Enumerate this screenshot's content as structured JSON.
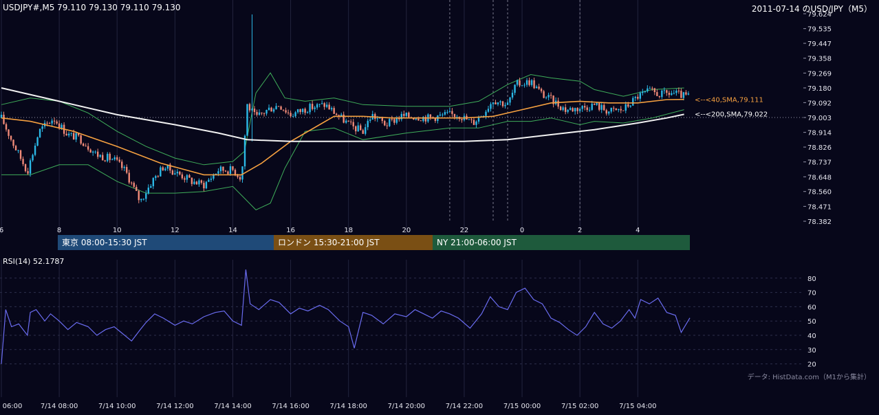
{
  "header": {
    "symbol_line": "USDJPY#,M5 79.110 79.130 79.110 79.130",
    "date_title": "2011-07-14 のUSD/JPY（M5）"
  },
  "sessions": [
    {
      "label": "東京 08:00-15:30 JST",
      "color": "#1f4a78"
    },
    {
      "label": "ロンドン 15:30-21:00 JST",
      "color": "#7a4f14"
    },
    {
      "label": "NY 21:00-06:00 JST",
      "color": "#1e5a3c"
    }
  ],
  "rsi": {
    "title": "RSI(14) 52.1787"
  },
  "credit": "データ: HistData.com（M1から集計）",
  "colors": {
    "background": "#07071a",
    "candle_up": "#2bb8e6",
    "candle_down": "#f08a78",
    "sma40": "#f5a040",
    "sma200": "#f2f2f2",
    "bollinger": "#3fae5a",
    "rsi_line": "#6a6cf0"
  },
  "chart_data": [
    {
      "type": "candlestick",
      "title": "USDJPY#,M5",
      "y_ticks": [
        "79.624",
        "79.535",
        "79.447",
        "79.358",
        "79.269",
        "79.180",
        "79.092",
        "79.003",
        "78.914",
        "78.826",
        "78.737",
        "78.648",
        "78.560",
        "78.471",
        "78.382"
      ],
      "ylim": [
        78.382,
        79.624
      ],
      "x_ticks": [
        "6",
        "8",
        "10",
        "12",
        "14",
        "16",
        "18",
        "20",
        "22",
        "0",
        "2",
        "4"
      ],
      "x_tick_hours": [
        6,
        8,
        10,
        12,
        14,
        16,
        18,
        20,
        22,
        24,
        26,
        28
      ],
      "x_range_hours": [
        6,
        29.8
      ],
      "grid": true,
      "close_path": [
        [
          6.0,
          79.0
        ],
        [
          6.4,
          78.85
        ],
        [
          6.9,
          78.68
        ],
        [
          7.3,
          78.92
        ],
        [
          7.8,
          79.0
        ],
        [
          8.3,
          78.9
        ],
        [
          8.7,
          78.88
        ],
        [
          9.3,
          78.78
        ],
        [
          9.9,
          78.75
        ],
        [
          10.3,
          78.68
        ],
        [
          10.6,
          78.57
        ],
        [
          10.8,
          78.5
        ],
        [
          11.2,
          78.62
        ],
        [
          11.6,
          78.71
        ],
        [
          12.2,
          78.66
        ],
        [
          12.6,
          78.62
        ],
        [
          13.0,
          78.6
        ],
        [
          13.5,
          78.69
        ],
        [
          14.0,
          78.69
        ],
        [
          14.3,
          78.64
        ],
        [
          14.5,
          79.08
        ],
        [
          14.8,
          79.0
        ],
        [
          15.2,
          79.05
        ],
        [
          15.6,
          79.08
        ],
        [
          16.0,
          79.02
        ],
        [
          16.6,
          79.06
        ],
        [
          17.2,
          79.08
        ],
        [
          17.6,
          79.02
        ],
        [
          18.1,
          78.95
        ],
        [
          18.5,
          78.92
        ],
        [
          18.8,
          79.02
        ],
        [
          19.3,
          78.96
        ],
        [
          19.8,
          79.01
        ],
        [
          20.3,
          79.01
        ],
        [
          20.8,
          79.0
        ],
        [
          21.4,
          79.02
        ],
        [
          21.8,
          79.02
        ],
        [
          22.3,
          78.97
        ],
        [
          22.7,
          79.04
        ],
        [
          23.0,
          79.11
        ],
        [
          23.5,
          79.08
        ],
        [
          23.8,
          79.2
        ],
        [
          24.3,
          79.22
        ],
        [
          24.7,
          79.14
        ],
        [
          25.1,
          79.1
        ],
        [
          25.5,
          79.05
        ],
        [
          26.0,
          79.06
        ],
        [
          26.5,
          79.08
        ],
        [
          27.0,
          79.04
        ],
        [
          27.5,
          79.05
        ],
        [
          28.0,
          79.13
        ],
        [
          28.4,
          79.16
        ],
        [
          28.8,
          79.14
        ],
        [
          29.2,
          79.15
        ],
        [
          29.6,
          79.13
        ]
      ],
      "spike": {
        "hour": 14.65,
        "high": 79.62,
        "low": 78.86
      },
      "lines": [
        {
          "name": "40,SMA",
          "label": "<--<40,SMA,79.111",
          "last": 79.111,
          "points": [
            [
              6.0,
              79.0
            ],
            [
              7.0,
              78.98
            ],
            [
              8.5,
              78.92
            ],
            [
              10.0,
              78.83
            ],
            [
              11.5,
              78.73
            ],
            [
              13.0,
              78.66
            ],
            [
              14.3,
              78.66
            ],
            [
              15.0,
              78.73
            ],
            [
              16.0,
              78.86
            ],
            [
              17.0,
              78.96
            ],
            [
              17.5,
              79.01
            ],
            [
              18.5,
              79.01
            ],
            [
              19.5,
              79.0
            ],
            [
              21.0,
              79.0
            ],
            [
              22.0,
              79.0
            ],
            [
              23.0,
              79.01
            ],
            [
              24.0,
              79.05
            ],
            [
              25.0,
              79.09
            ],
            [
              26.0,
              79.1
            ],
            [
              27.0,
              79.09
            ],
            [
              28.0,
              79.09
            ],
            [
              29.0,
              79.11
            ],
            [
              29.6,
              79.111
            ]
          ]
        },
        {
          "name": "200,SMA",
          "label": "<--<200,SMA,79.022",
          "last": 79.022,
          "points": [
            [
              6.0,
              79.18
            ],
            [
              8.0,
              79.1
            ],
            [
              10.0,
              79.02
            ],
            [
              12.0,
              78.96
            ],
            [
              13.5,
              78.91
            ],
            [
              14.5,
              78.87
            ],
            [
              16.0,
              78.86
            ],
            [
              18.0,
              78.86
            ],
            [
              20.0,
              78.86
            ],
            [
              22.0,
              78.86
            ],
            [
              23.5,
              78.87
            ],
            [
              25.0,
              78.9
            ],
            [
              26.5,
              78.93
            ],
            [
              28.0,
              78.97
            ],
            [
              29.0,
              79.0
            ],
            [
              29.6,
              79.022
            ]
          ]
        }
      ],
      "bollinger": {
        "upper": [
          [
            6.0,
            79.08
          ],
          [
            7.0,
            79.12
          ],
          [
            8.0,
            79.1
          ],
          [
            9.0,
            79.03
          ],
          [
            10.0,
            78.92
          ],
          [
            11.0,
            78.83
          ],
          [
            12.0,
            78.76
          ],
          [
            13.0,
            78.72
          ],
          [
            14.0,
            78.74
          ],
          [
            14.4,
            78.8
          ],
          [
            14.8,
            79.15
          ],
          [
            15.3,
            79.27
          ],
          [
            15.8,
            79.12
          ],
          [
            16.5,
            79.1
          ],
          [
            17.5,
            79.12
          ],
          [
            18.5,
            79.08
          ],
          [
            20.0,
            79.07
          ],
          [
            21.5,
            79.07
          ],
          [
            22.5,
            79.1
          ],
          [
            23.5,
            79.2
          ],
          [
            24.3,
            79.26
          ],
          [
            25.0,
            79.24
          ],
          [
            26.0,
            79.22
          ],
          [
            26.5,
            79.17
          ],
          [
            27.5,
            79.13
          ],
          [
            28.5,
            79.17
          ],
          [
            29.6,
            79.18
          ]
        ],
        "lower": [
          [
            6.0,
            78.66
          ],
          [
            7.0,
            78.66
          ],
          [
            8.0,
            78.72
          ],
          [
            9.0,
            78.72
          ],
          [
            10.0,
            78.62
          ],
          [
            11.0,
            78.55
          ],
          [
            12.0,
            78.55
          ],
          [
            13.0,
            78.56
          ],
          [
            14.0,
            78.59
          ],
          [
            14.4,
            78.52
          ],
          [
            14.8,
            78.45
          ],
          [
            15.3,
            78.49
          ],
          [
            15.8,
            78.7
          ],
          [
            16.5,
            78.92
          ],
          [
            17.5,
            78.94
          ],
          [
            18.5,
            78.87
          ],
          [
            20.0,
            78.91
          ],
          [
            21.5,
            78.94
          ],
          [
            22.5,
            78.94
          ],
          [
            23.5,
            78.98
          ],
          [
            24.3,
            78.98
          ],
          [
            25.0,
            79.0
          ],
          [
            26.0,
            78.96
          ],
          [
            26.5,
            78.98
          ],
          [
            27.5,
            78.97
          ],
          [
            28.5,
            79.0
          ],
          [
            29.6,
            79.05
          ]
        ]
      },
      "current_price_line": 79.003,
      "session_markers_hours": [
        21.5,
        23.0,
        23.5,
        26.0
      ]
    },
    {
      "type": "line",
      "title": "RSI(14) 52.1787",
      "y_ticks": [
        "80",
        "70",
        "60",
        "50",
        "40",
        "30",
        "20"
      ],
      "y_tick_values": [
        80,
        70,
        60,
        50,
        40,
        30,
        20
      ],
      "ylim": [
        15,
        90
      ],
      "x_ticks": [
        "06:00",
        "7/14 08:00",
        "7/14 10:00",
        "7/14 12:00",
        "7/14 14:00",
        "7/14 16:00",
        "7/14 18:00",
        "7/14 20:00",
        "7/14 22:00",
        "7/15 00:00",
        "7/15 02:00",
        "7/15 04:00"
      ],
      "x_tick_hours": [
        6,
        8,
        10,
        12,
        14,
        16,
        18,
        20,
        22,
        24,
        26,
        28
      ],
      "series": [
        {
          "points": [
            [
              6.0,
              20
            ],
            [
              6.15,
              58
            ],
            [
              6.35,
              46
            ],
            [
              6.6,
              48
            ],
            [
              6.9,
              40
            ],
            [
              7.0,
              56
            ],
            [
              7.2,
              58
            ],
            [
              7.5,
              50
            ],
            [
              7.7,
              55
            ],
            [
              8.0,
              50
            ],
            [
              8.3,
              44
            ],
            [
              8.6,
              49
            ],
            [
              9.0,
              46
            ],
            [
              9.3,
              40
            ],
            [
              9.6,
              44
            ],
            [
              9.9,
              46
            ],
            [
              10.2,
              41
            ],
            [
              10.5,
              36
            ],
            [
              10.8,
              44
            ],
            [
              11.0,
              49
            ],
            [
              11.3,
              55
            ],
            [
              11.6,
              52
            ],
            [
              12.0,
              47
            ],
            [
              12.3,
              50
            ],
            [
              12.6,
              48
            ],
            [
              13.0,
              53
            ],
            [
              13.4,
              56
            ],
            [
              13.7,
              57
            ],
            [
              14.0,
              50
            ],
            [
              14.3,
              47
            ],
            [
              14.45,
              86
            ],
            [
              14.6,
              62
            ],
            [
              14.9,
              58
            ],
            [
              15.3,
              65
            ],
            [
              15.6,
              63
            ],
            [
              16.0,
              55
            ],
            [
              16.3,
              59
            ],
            [
              16.6,
              57
            ],
            [
              17.0,
              61
            ],
            [
              17.3,
              58
            ],
            [
              17.7,
              50
            ],
            [
              18.0,
              46
            ],
            [
              18.2,
              31
            ],
            [
              18.5,
              56
            ],
            [
              18.8,
              54
            ],
            [
              19.2,
              48
            ],
            [
              19.6,
              55
            ],
            [
              20.0,
              53
            ],
            [
              20.3,
              58
            ],
            [
              20.6,
              55
            ],
            [
              20.9,
              52
            ],
            [
              21.2,
              57
            ],
            [
              21.5,
              55
            ],
            [
              21.8,
              52
            ],
            [
              22.2,
              45
            ],
            [
              22.6,
              55
            ],
            [
              22.9,
              67
            ],
            [
              23.2,
              60
            ],
            [
              23.5,
              58
            ],
            [
              23.8,
              70
            ],
            [
              24.1,
              73
            ],
            [
              24.4,
              65
            ],
            [
              24.7,
              62
            ],
            [
              25.0,
              52
            ],
            [
              25.3,
              49
            ],
            [
              25.6,
              44
            ],
            [
              25.9,
              40
            ],
            [
              26.2,
              46
            ],
            [
              26.5,
              56
            ],
            [
              26.8,
              48
            ],
            [
              27.1,
              45
            ],
            [
              27.4,
              50
            ],
            [
              27.7,
              58
            ],
            [
              27.9,
              52
            ],
            [
              28.1,
              65
            ],
            [
              28.4,
              62
            ],
            [
              28.7,
              66
            ],
            [
              29.0,
              56
            ],
            [
              29.3,
              54
            ],
            [
              29.5,
              42
            ],
            [
              29.8,
              52.18
            ]
          ]
        }
      ],
      "grid": true
    }
  ]
}
